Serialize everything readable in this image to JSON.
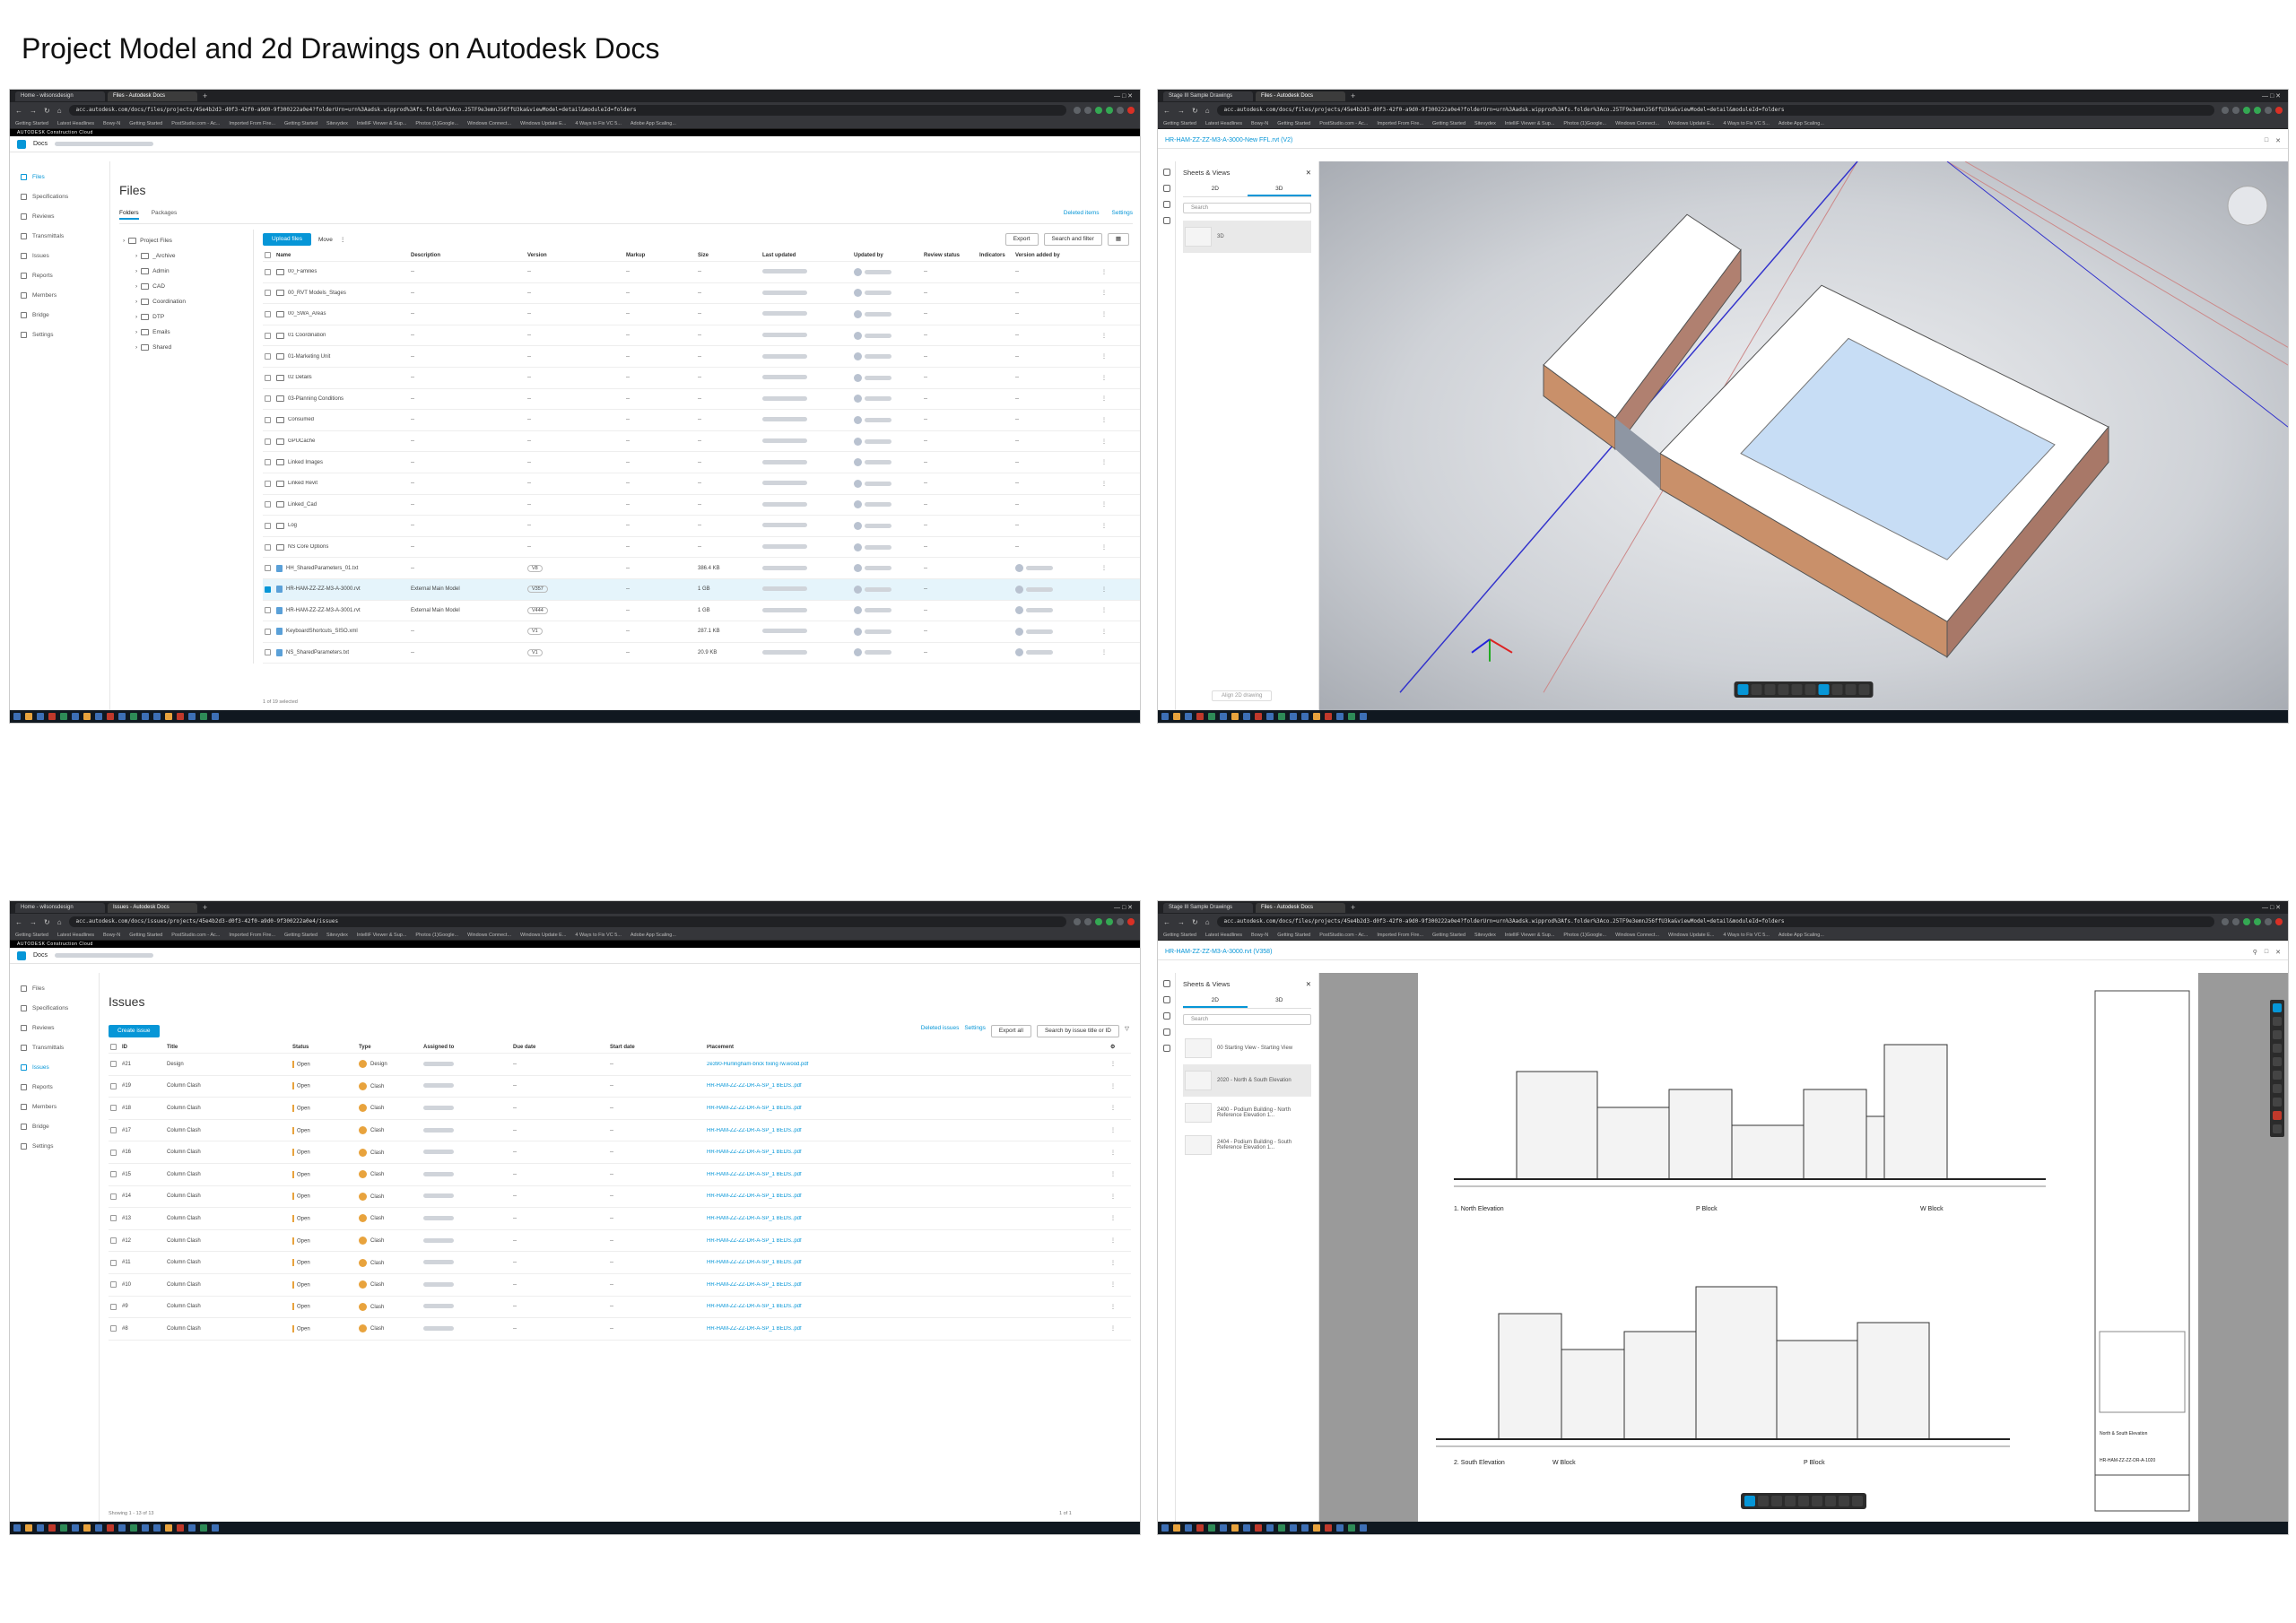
{
  "page_title": "Project Model and 2d Drawings on  Autodesk Docs",
  "files_shot": {
    "tabs": [
      "Home - wilsonsdesign",
      "Files - Autodesk Docs"
    ],
    "url": "acc.autodesk.com/docs/files/projects/45e4b2d3-d0f3-42f0-a9d0-9f300222a0e4?folderUrn=urn%3Aadsk.wipprod%3Afs.folder%3Aco.25TF9e3emnJ56ffU3ka&viewModel=detail&moduleId=folders",
    "bookmarks": [
      "Getting Started",
      "Latest Headlines",
      "Bowy-N",
      "Getting Started",
      "PostStudio.com - Ac...",
      "Imported From Fire...",
      "Getting Started",
      "Sitevydex",
      "IntelliF Viewer & Sup...",
      "Photos (1)Google...",
      "Windows Connect...",
      "Windows Update E...",
      "4 Ways to Fix VC 5...",
      "Adobe App Scaling..."
    ],
    "acc_label": "AUTODESK Construction Cloud",
    "app_name": "Docs",
    "nav": [
      "Files",
      "Specifications",
      "Reviews",
      "Transmittals",
      "Issues",
      "Reports",
      "Members",
      "Bridge",
      "Settings"
    ],
    "heading": "Files",
    "subtabs": [
      "Folders",
      "Packages"
    ],
    "top_right": [
      "Deleted items",
      "Settings"
    ],
    "tree": [
      "Project Files",
      "_Archive",
      "Admin",
      "CAD",
      "Coordination",
      "DTP",
      "Emails",
      "Shared"
    ],
    "toolbar": {
      "upload": "Upload files",
      "move": "Move",
      "export": "Export",
      "search": "Search and filter"
    },
    "columns": [
      "Name",
      "Description",
      "Version",
      "Markup",
      "Size",
      "Last updated",
      "Updated by",
      "Review status",
      "Indicators",
      "Version added by"
    ],
    "rows": [
      {
        "name": "00_Families",
        "desc": "--",
        "ver": "--",
        "mark": "--",
        "size": "--"
      },
      {
        "name": "00_RVT Models_Stages",
        "desc": "--",
        "ver": "--",
        "mark": "--",
        "size": "--"
      },
      {
        "name": "00_SWA_Areas",
        "desc": "--",
        "ver": "--",
        "mark": "--",
        "size": "--"
      },
      {
        "name": "01 Coordination",
        "desc": "--",
        "ver": "--",
        "mark": "--",
        "size": "--"
      },
      {
        "name": "01-Marketing Unit",
        "desc": "--",
        "ver": "--",
        "mark": "--",
        "size": "--"
      },
      {
        "name": "02 Details",
        "desc": "--",
        "ver": "--",
        "mark": "--",
        "size": "--"
      },
      {
        "name": "03-Planning Conditions",
        "desc": "--",
        "ver": "--",
        "mark": "--",
        "size": "--"
      },
      {
        "name": "Consumed",
        "desc": "--",
        "ver": "--",
        "mark": "--",
        "size": "--"
      },
      {
        "name": "GPUCache",
        "desc": "--",
        "ver": "--",
        "mark": "--",
        "size": "--"
      },
      {
        "name": "Linked Images",
        "desc": "--",
        "ver": "--",
        "mark": "--",
        "size": "--"
      },
      {
        "name": "Linked Revit",
        "desc": "--",
        "ver": "--",
        "mark": "--",
        "size": "--"
      },
      {
        "name": "Linked_Cad",
        "desc": "--",
        "ver": "--",
        "mark": "--",
        "size": "--"
      },
      {
        "name": "Log",
        "desc": "--",
        "ver": "--",
        "mark": "--",
        "size": "--"
      },
      {
        "name": "NS Core Options",
        "desc": "--",
        "ver": "--",
        "mark": "--",
        "size": "--"
      },
      {
        "name": "HH_SharedParameters_01.txt",
        "desc": "--",
        "ver": "V8",
        "mark": "--",
        "size": "386.4 KB"
      },
      {
        "name": "HR-HAM-ZZ-ZZ-M3-A-3000.rvt",
        "desc": "External Main Model",
        "ver": "V357",
        "mark": "--",
        "size": "1 GB"
      },
      {
        "name": "HR-HAM-ZZ-ZZ-M3-A-3001.rvt",
        "desc": "External Main Model",
        "ver": "V444",
        "mark": "--",
        "size": "1 GB"
      },
      {
        "name": "KeyboardShortcuts_SISO.xml",
        "desc": "--",
        "ver": "V1",
        "mark": "--",
        "size": "287.1 KB"
      },
      {
        "name": "NS_SharedParameters.txt",
        "desc": "--",
        "ver": "V1",
        "mark": "--",
        "size": "20.9 KB"
      }
    ],
    "footer": "1 of 19 selected"
  },
  "model_shot": {
    "tabs": [
      "Stage III Sample Drawings",
      "Files - Autodesk Docs"
    ],
    "file_label": "HR-HAM-ZZ-ZZ-M3-A-3000-New FFL.rvt (V2)",
    "panel_title": "Sheets & Views",
    "panel_tabs": [
      "2D",
      "3D"
    ],
    "search": "Search",
    "item": "3D",
    "align_btn": "Align 2D drawing"
  },
  "issues_shot": {
    "tabs": [
      "Home - wilsonsdesign",
      "Issues - Autodesk Docs"
    ],
    "url": "acc.autodesk.com/docs/issues/projects/45e4b2d3-d0f3-42f0-a9d0-9f300222a0e4/issues",
    "heading": "Issues",
    "top_right": [
      "Deleted issues",
      "Settings"
    ],
    "create": "Create issue",
    "export": "Export all",
    "search": "Search by issue title or ID",
    "columns": [
      "ID",
      "Title",
      "Status",
      "Type",
      "Assigned to",
      "Due date",
      "Start date",
      "Placement"
    ],
    "rows": [
      {
        "id": "#21",
        "title": "Design",
        "status": "Open",
        "type": "Design",
        "due": "--",
        "start": "--",
        "place": "2e390-Hurlingham-brick fixing rw.wood.pdf"
      },
      {
        "id": "#19",
        "title": "Column Clash",
        "status": "Open",
        "type": "Clash",
        "due": "--",
        "start": "--",
        "place": "HR-HAM-ZZ-ZZ-DR-A-SP_1 BEDS..pdf"
      },
      {
        "id": "#18",
        "title": "Column Clash",
        "status": "Open",
        "type": "Clash",
        "due": "--",
        "start": "--",
        "place": "HR-HAM-ZZ-ZZ-DR-A-SP_1 BEDS..pdf"
      },
      {
        "id": "#17",
        "title": "Column Clash",
        "status": "Open",
        "type": "Clash",
        "due": "--",
        "start": "--",
        "place": "HR-HAM-ZZ-ZZ-DR-A-SP_1 BEDS..pdf"
      },
      {
        "id": "#16",
        "title": "Column Clash",
        "status": "Open",
        "type": "Clash",
        "due": "--",
        "start": "--",
        "place": "HR-HAM-ZZ-ZZ-DR-A-SP_1 BEDS..pdf"
      },
      {
        "id": "#15",
        "title": "Column Clash",
        "status": "Open",
        "type": "Clash",
        "due": "--",
        "start": "--",
        "place": "HR-HAM-ZZ-ZZ-DR-A-SP_1 BEDS..pdf"
      },
      {
        "id": "#14",
        "title": "Column Clash",
        "status": "Open",
        "type": "Clash",
        "due": "--",
        "start": "--",
        "place": "HR-HAM-ZZ-ZZ-DR-A-SP_1 BEDS..pdf"
      },
      {
        "id": "#13",
        "title": "Column Clash",
        "status": "Open",
        "type": "Clash",
        "due": "--",
        "start": "--",
        "place": "HR-HAM-ZZ-ZZ-DR-A-SP_1 BEDS..pdf"
      },
      {
        "id": "#12",
        "title": "Column Clash",
        "status": "Open",
        "type": "Clash",
        "due": "--",
        "start": "--",
        "place": "HR-HAM-ZZ-ZZ-DR-A-SP_1 BEDS..pdf"
      },
      {
        "id": "#11",
        "title": "Column Clash",
        "status": "Open",
        "type": "Clash",
        "due": "--",
        "start": "--",
        "place": "HR-HAM-ZZ-ZZ-DR-A-SP_1 BEDS..pdf"
      },
      {
        "id": "#10",
        "title": "Column Clash",
        "status": "Open",
        "type": "Clash",
        "due": "--",
        "start": "--",
        "place": "HR-HAM-ZZ-ZZ-DR-A-SP_1 BEDS..pdf"
      },
      {
        "id": "#9",
        "title": "Column Clash",
        "status": "Open",
        "type": "Clash",
        "due": "--",
        "start": "--",
        "place": "HR-HAM-ZZ-ZZ-DR-A-SP_1 BEDS..pdf"
      },
      {
        "id": "#8",
        "title": "Column Clash",
        "status": "Open",
        "type": "Clash",
        "due": "--",
        "start": "--",
        "place": "HR-HAM-ZZ-ZZ-DR-A-SP_1 BEDS..pdf"
      }
    ],
    "footer": "Showing 1 - 13 of 13",
    "pager": "1 of 1"
  },
  "drawing_shot": {
    "tabs": [
      "Stage III Sample Drawings",
      "Files - Autodesk Docs"
    ],
    "file_label": "HR-HAM-ZZ-ZZ-M3-A-3000.rvt (V358)",
    "panel_title": "Sheets & Views",
    "panel_tabs": [
      "2D",
      "3D"
    ],
    "search": "Search",
    "items": [
      "00 Starting View - Starting View",
      "2020 - North & South Elevation",
      "2400 - Podium Building - North Reference Elevation 1...",
      "2404 - Podium Building - South Reference Elevation 1..."
    ],
    "elev_labels": [
      "1. North Elevation",
      "P Block",
      "W Block",
      "2. South Elevation",
      "W Block",
      "P Block"
    ],
    "title_block": [
      "North & South Elevation",
      "HR-HAM-ZZ-ZZ-DR-A-1020"
    ]
  }
}
